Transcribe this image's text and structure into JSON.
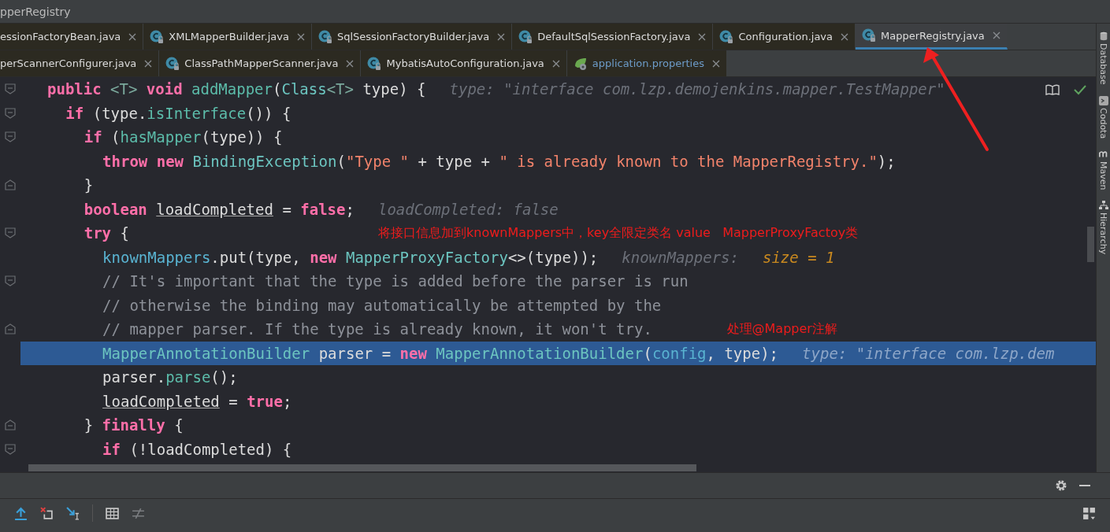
{
  "window": {
    "title": "pperRegistry"
  },
  "tab_rows": [
    [
      {
        "label": "essionFactoryBean.java",
        "selected": false
      },
      {
        "label": "XMLMapperBuilder.java",
        "kind": "class",
        "selected": false
      },
      {
        "label": "SqlSessionFactoryBuilder.java",
        "kind": "class",
        "selected": false
      },
      {
        "label": "DefaultSqlSessionFactory.java",
        "kind": "class",
        "selected": false
      },
      {
        "label": "Configuration.java",
        "kind": "class",
        "selected": false
      },
      {
        "label": "MapperRegistry.java",
        "kind": "class",
        "selected": true
      }
    ],
    [
      {
        "label": "perScannerConfigurer.java",
        "selected": false
      },
      {
        "label": "ClassPathMapperScanner.java",
        "kind": "class",
        "selected": false
      },
      {
        "label": "MybatisAutoConfiguration.java",
        "kind": "class",
        "selected": false
      },
      {
        "label": "application.properties",
        "kind": "properties",
        "selected": false
      }
    ]
  ],
  "code_lines": [
    {
      "kind": "fold_start",
      "highlighted": false,
      "tokens": [
        {
          "kind": "kw",
          "text": "public"
        },
        {
          "kind": "tp",
          "text": " <T>"
        },
        {
          "kind": "kw",
          "text": " void"
        },
        {
          "kind": "fn",
          "text": " addMapper"
        },
        {
          "kind": "plain",
          "text": "("
        },
        {
          "kind": "cls",
          "text": "Class"
        },
        {
          "kind": "tp",
          "text": "<T>"
        },
        {
          "kind": "plain",
          "text": " type) {"
        }
      ],
      "hints": [
        {
          "kind": "hint",
          "text": "type: \"interface com.lzp.demojenkins.mapper.TestMapper\""
        }
      ],
      "children": [
        {
          "kind": "fold_start",
          "highlighted": false,
          "tokens": [
            {
              "kind": "kw",
              "text": "if"
            },
            {
              "kind": "plain",
              "text": " (type."
            },
            {
              "kind": "fn",
              "text": "isInterface"
            },
            {
              "kind": "plain",
              "text": "()) {"
            }
          ],
          "children": [
            {
              "kind": "fold_start",
              "highlighted": false,
              "tokens": [
                {
                  "kind": "kw",
                  "text": "if"
                },
                {
                  "kind": "plain",
                  "text": " ("
                },
                {
                  "kind": "fn",
                  "text": "hasMapper"
                },
                {
                  "kind": "plain",
                  "text": "(type)) {"
                }
              ],
              "children": [
                {
                  "kind": "plain",
                  "highlighted": false,
                  "tokens": [
                    {
                      "kind": "kw",
                      "text": "throw new"
                    },
                    {
                      "kind": "cls",
                      "text": " BindingException"
                    },
                    {
                      "kind": "plain",
                      "text": "("
                    },
                    {
                      "kind": "str",
                      "text": "\"Type \""
                    },
                    {
                      "kind": "plain",
                      "text": " + type + "
                    },
                    {
                      "kind": "str",
                      "text": "\" is already known to the MapperRegistry.\""
                    },
                    {
                      "kind": "plain",
                      "text": ");"
                    }
                  ]
                }
              ]
            },
            {
              "kind": "fold_end",
              "highlighted": false,
              "tokens": [
                {
                  "kind": "plain",
                  "text": "}"
                }
              ]
            },
            {
              "kind": "plain",
              "highlighted": false,
              "tokens": [
                {
                  "kind": "kw",
                  "text": "boolean "
                },
                {
                  "kind": "var",
                  "text": "loadCompleted"
                },
                {
                  "kind": "plain",
                  "text": " = "
                },
                {
                  "kind": "kw",
                  "text": "false"
                },
                {
                  "kind": "plain",
                  "text": ";"
                }
              ],
              "hints": [
                {
                  "kind": "hint",
                  "text": "loadCompleted: false"
                }
              ]
            },
            {
              "kind": "fold_start",
              "highlighted": false,
              "tokens": [
                {
                  "kind": "kw",
                  "text": "try"
                },
                {
                  "kind": "plain",
                  "text": " {"
                }
              ],
              "note": "将接口信息加到knownMappers中，key全限定类名 value   MapperProxyFactoy类",
              "children": [
                {
                  "kind": "plain",
                  "highlighted": false,
                  "tokens": [
                    {
                      "kind": "field",
                      "text": "knownMappers"
                    },
                    {
                      "kind": "plain",
                      "text": ".put(type, "
                    },
                    {
                      "kind": "kw",
                      "text": "new"
                    },
                    {
                      "kind": "cls",
                      "text": " MapperProxyFactory"
                    },
                    {
                      "kind": "plain",
                      "text": "<>(type));"
                    }
                  ],
                  "hints": [
                    {
                      "kind": "hint",
                      "text": "knownMappers:"
                    },
                    {
                      "kind": "hintval",
                      "text": "size = 1"
                    }
                  ]
                },
                {
                  "kind": "fold_start",
                  "highlighted": false,
                  "tokens": [
                    {
                      "kind": "comment",
                      "text": "// It's important that the type is added before the parser is run"
                    }
                  ]
                },
                {
                  "kind": "plain",
                  "highlighted": false,
                  "tokens": [
                    {
                      "kind": "comment",
                      "text": "// otherwise the binding may automatically be attempted by the"
                    }
                  ]
                },
                {
                  "kind": "fold_end",
                  "highlighted": false,
                  "tokens": [
                    {
                      "kind": "comment",
                      "text": "// mapper parser. If the type is already known, it won't try."
                    }
                  ],
                  "note": "处理@Mapper注解"
                },
                {
                  "kind": "plain",
                  "highlighted": true,
                  "tokens": [
                    {
                      "kind": "cls",
                      "text": "MapperAnnotationBuilder"
                    },
                    {
                      "kind": "plain",
                      "text": " parser = "
                    },
                    {
                      "kind": "kw",
                      "text": "new"
                    },
                    {
                      "kind": "cls",
                      "text": " MapperAnnotationBuilder"
                    },
                    {
                      "kind": "plain",
                      "text": "("
                    },
                    {
                      "kind": "field",
                      "text": "config"
                    },
                    {
                      "kind": "plain",
                      "text": ", type);"
                    }
                  ],
                  "hints": [
                    {
                      "kind": "hint",
                      "text": "type: \"interface com.lzp.dem"
                    }
                  ]
                },
                {
                  "kind": "plain",
                  "highlighted": false,
                  "tokens": [
                    {
                      "kind": "plain",
                      "text": "parser."
                    },
                    {
                      "kind": "fn",
                      "text": "parse"
                    },
                    {
                      "kind": "plain",
                      "text": "();"
                    }
                  ]
                },
                {
                  "kind": "plain",
                  "highlighted": false,
                  "tokens": [
                    {
                      "kind": "var",
                      "text": "loadCompleted"
                    },
                    {
                      "kind": "plain",
                      "text": " = "
                    },
                    {
                      "kind": "kw",
                      "text": "true"
                    },
                    {
                      "kind": "plain",
                      "text": ";"
                    }
                  ]
                }
              ]
            },
            {
              "kind": "fold_end",
              "highlighted": false,
              "tokens": [
                {
                  "kind": "plain",
                  "text": "} "
                },
                {
                  "kind": "kw",
                  "text": "finally"
                },
                {
                  "kind": "plain",
                  "text": " {"
                }
              ],
              "children": [
                {
                  "kind": "fold_start",
                  "highlighted": false,
                  "tokens": [
                    {
                      "kind": "kw",
                      "text": "if"
                    },
                    {
                      "kind": "plain",
                      "text": " (!loadCompleted) {"
                    }
                  ]
                }
              ]
            }
          ]
        }
      ]
    }
  ],
  "side_tools": [
    {
      "label": "Database",
      "kind": "database"
    },
    {
      "label": "Codota",
      "kind": "codota"
    },
    {
      "label": "Maven",
      "kind": "maven"
    },
    {
      "label": "Hierarchy",
      "kind": "hierarchy"
    }
  ]
}
